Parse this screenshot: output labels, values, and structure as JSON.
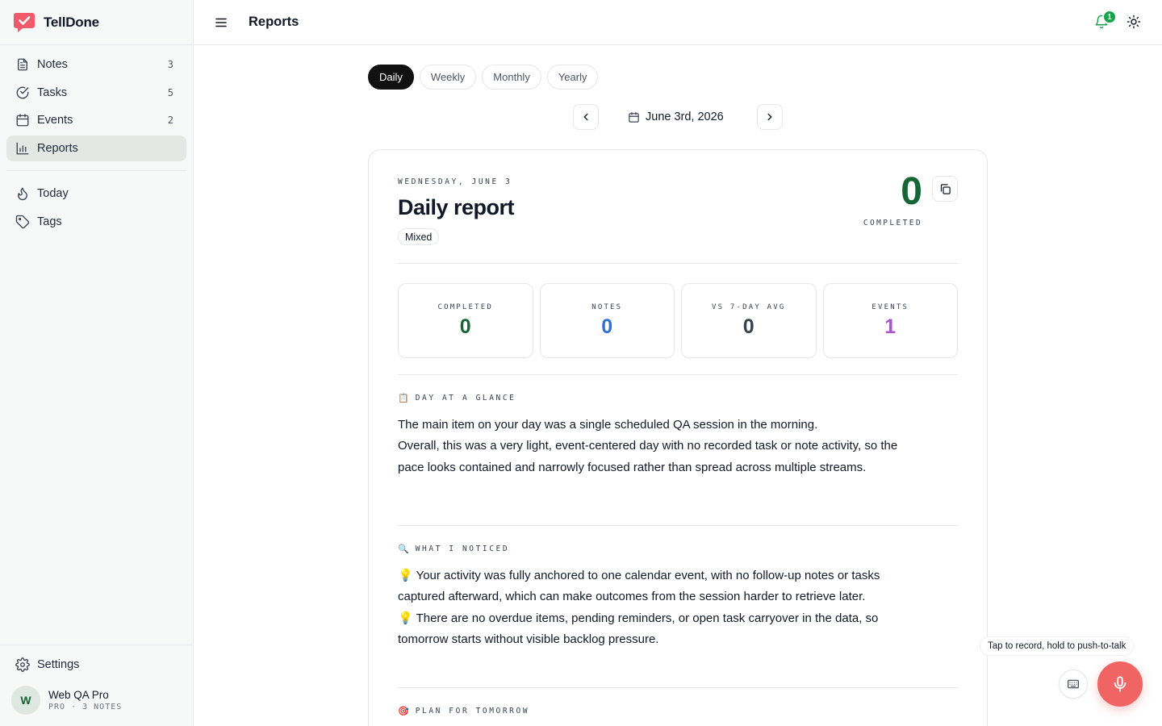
{
  "app": {
    "name": "TellDone"
  },
  "colors": {
    "brand": "#f05a6a",
    "active_nav": "#e3e8e5",
    "completed": "#166534",
    "notes": "#2f6fd6",
    "events": "#a855c7",
    "mic": "#f06464"
  },
  "sidebar": {
    "nav": [
      {
        "label": "Notes",
        "count": "3",
        "icon": "notes-icon"
      },
      {
        "label": "Tasks",
        "count": "5",
        "icon": "tasks-icon"
      },
      {
        "label": "Events",
        "count": "2",
        "icon": "calendar-icon"
      },
      {
        "label": "Reports",
        "count": "",
        "icon": "bar-chart-icon",
        "active": true
      }
    ],
    "secondary": [
      {
        "label": "Today",
        "icon": "flame-icon"
      },
      {
        "label": "Tags",
        "icon": "tag-icon"
      }
    ],
    "settings_label": "Settings",
    "user": {
      "initial": "W",
      "name": "Web QA Pro",
      "meta": "PRO · 3 NOTES"
    }
  },
  "header": {
    "title": "Reports",
    "notification_count": "1"
  },
  "period_tabs": [
    {
      "label": "Daily",
      "active": true
    },
    {
      "label": "Weekly"
    },
    {
      "label": "Monthly"
    },
    {
      "label": "Yearly"
    }
  ],
  "date_nav": {
    "label": "June 3rd, 2026"
  },
  "report": {
    "eyebrow": "WEDNESDAY, JUNE 3",
    "title": "Daily report",
    "chip": "Mixed",
    "completed_value": "0",
    "completed_label": "COMPLETED",
    "stats": [
      {
        "label": "COMPLETED",
        "value": "0",
        "color": "#166534"
      },
      {
        "label": "NOTES",
        "value": "0",
        "color": "#2f6fd6"
      },
      {
        "label": "VS 7-DAY AVG",
        "value": "0",
        "color": "#374151"
      },
      {
        "label": "EVENTS",
        "value": "1",
        "color": "#a855c7"
      }
    ],
    "sections": [
      {
        "emoji": "📋",
        "heading": "DAY AT A GLANCE",
        "lines": [
          "The main item on your day was a single scheduled QA session in the morning.",
          "Overall, this was a very light, event-centered day with no recorded task or note activity, so the pace looks contained and narrowly focused rather than spread across multiple streams."
        ]
      },
      {
        "emoji": "🔍",
        "heading": "WHAT I NOTICED",
        "lines": [
          "💡 Your activity was fully anchored to one calendar event, with no follow-up notes or tasks captured afterward, which can make outcomes from the session harder to retrieve later.",
          "💡 There are no overdue items, pending reminders, or open task carryover in the data, so tomorrow starts without visible backlog pressure."
        ]
      },
      {
        "emoji": "🎯",
        "heading": "PLAN FOR TOMORROW",
        "lines": []
      }
    ]
  },
  "recorder": {
    "tooltip": "Tap to record, hold to push-to-talk"
  }
}
